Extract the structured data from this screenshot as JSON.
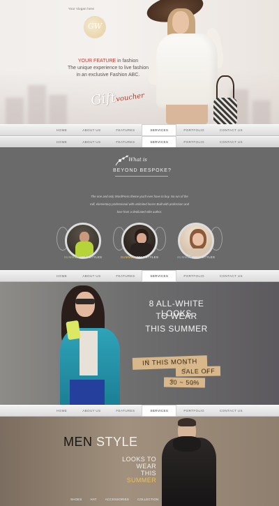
{
  "hero": {
    "slogan": "Your slogan here",
    "logo_text": "GW",
    "feature_highlight": "YOUR FEATURE",
    "feature_rest": " in fashion",
    "line2": "The unique experience to live fashion",
    "line3": "in an exclusive Fashion ABC.",
    "signature_main": "Gift",
    "signature_accent": "voucher"
  },
  "nav": {
    "items": [
      "HOME",
      "ABOUT US",
      "FEATURES",
      "SERVICES",
      "PORTFOLIO",
      "CONTACT US"
    ],
    "active_index": 3
  },
  "bespoke": {
    "title_line1": "What is",
    "title_line2": "BEYOND BESPOKE?",
    "paragraph_1": "The one and only WordPress theme you'll ever have to buy. No run of the",
    "paragraph_2": "mill, elementary professional with unlimited faces! Built with profession and",
    "paragraph_3": "love from a dedicated elite author.",
    "circles": [
      {
        "highlight": "SUMMER",
        "rest": " 2014 STYLES"
      },
      {
        "highlight": "SUMMER",
        "rest": " 2014 STYLES"
      },
      {
        "highlight": "SUMMER",
        "rest": " 2014 STYLES"
      }
    ]
  },
  "looks": {
    "headline_1": "8 ALL-WHITE LOOKS",
    "headline_2": "TO WEAR",
    "headline_3": "THIS SUMMER",
    "tag_1": "IN THIS MONTH",
    "tag_2": "SALE OFF",
    "tag_3": "30 ~ 50%"
  },
  "men": {
    "title_dark": "MEN",
    "title_light": " STYLE",
    "sub_1": "LOOKS TO",
    "sub_2": "WEAR",
    "sub_3_pre": "THIS ",
    "sub_3_hl": "SUMMER",
    "links": [
      "SHOES",
      "HAT",
      "ACCESSORIES",
      "COLLECTION"
    ]
  },
  "colors": {
    "accent_red": "#c0392b",
    "summer_green": "#a6d13a",
    "summer_yellow": "#f0c24b",
    "summer_blue": "#7fc3e8"
  }
}
